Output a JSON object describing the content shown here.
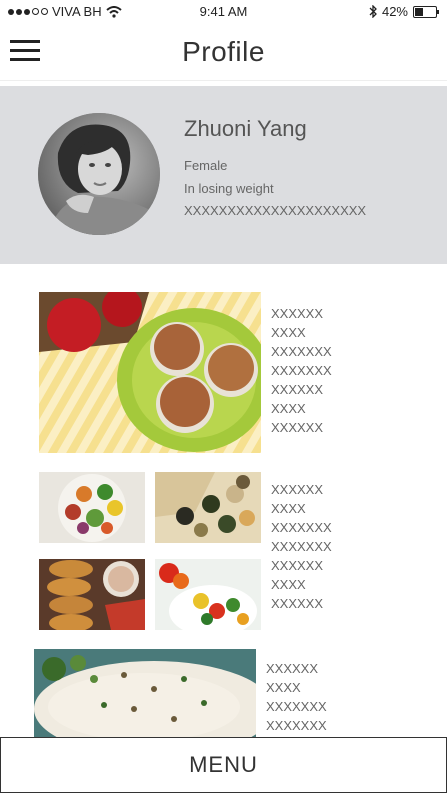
{
  "status_bar": {
    "carrier": "VIVA BH",
    "time": "9:41 AM",
    "battery": "42%",
    "battery_level": 0.42
  },
  "header": {
    "title": "Profile"
  },
  "profile": {
    "name": "Zhuoni Yang",
    "gender": "Female",
    "goal": "In losing weight",
    "note": "XXXXXXXXXXXXXXXXXXXXX"
  },
  "feed": [
    {
      "lines": [
        "XXXXXX",
        "XXXX",
        "XXXXXXX",
        "XXXXXXX",
        "XXXXXX",
        "XXXX",
        "XXXXXX"
      ]
    },
    {
      "lines": [
        "XXXXXX",
        "XXXX",
        "XXXXXXX",
        "XXXXXXX",
        "XXXXXX",
        "XXXX",
        "XXXXXX"
      ]
    },
    {
      "lines": [
        "XXXXXX",
        "XXXX",
        "XXXXXXX",
        "XXXXXXX"
      ]
    }
  ],
  "menu": {
    "label": "MENU"
  }
}
